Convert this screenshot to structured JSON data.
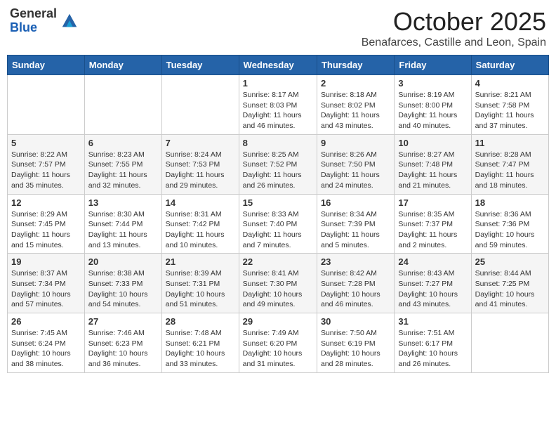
{
  "header": {
    "logo_general": "General",
    "logo_blue": "Blue",
    "month": "October 2025",
    "location": "Benafarces, Castille and Leon, Spain"
  },
  "days_of_week": [
    "Sunday",
    "Monday",
    "Tuesday",
    "Wednesday",
    "Thursday",
    "Friday",
    "Saturday"
  ],
  "weeks": [
    [
      {
        "day": "",
        "info": ""
      },
      {
        "day": "",
        "info": ""
      },
      {
        "day": "",
        "info": ""
      },
      {
        "day": "1",
        "info": "Sunrise: 8:17 AM\nSunset: 8:03 PM\nDaylight: 11 hours and 46 minutes."
      },
      {
        "day": "2",
        "info": "Sunrise: 8:18 AM\nSunset: 8:02 PM\nDaylight: 11 hours and 43 minutes."
      },
      {
        "day": "3",
        "info": "Sunrise: 8:19 AM\nSunset: 8:00 PM\nDaylight: 11 hours and 40 minutes."
      },
      {
        "day": "4",
        "info": "Sunrise: 8:21 AM\nSunset: 7:58 PM\nDaylight: 11 hours and 37 minutes."
      }
    ],
    [
      {
        "day": "5",
        "info": "Sunrise: 8:22 AM\nSunset: 7:57 PM\nDaylight: 11 hours and 35 minutes."
      },
      {
        "day": "6",
        "info": "Sunrise: 8:23 AM\nSunset: 7:55 PM\nDaylight: 11 hours and 32 minutes."
      },
      {
        "day": "7",
        "info": "Sunrise: 8:24 AM\nSunset: 7:53 PM\nDaylight: 11 hours and 29 minutes."
      },
      {
        "day": "8",
        "info": "Sunrise: 8:25 AM\nSunset: 7:52 PM\nDaylight: 11 hours and 26 minutes."
      },
      {
        "day": "9",
        "info": "Sunrise: 8:26 AM\nSunset: 7:50 PM\nDaylight: 11 hours and 24 minutes."
      },
      {
        "day": "10",
        "info": "Sunrise: 8:27 AM\nSunset: 7:48 PM\nDaylight: 11 hours and 21 minutes."
      },
      {
        "day": "11",
        "info": "Sunrise: 8:28 AM\nSunset: 7:47 PM\nDaylight: 11 hours and 18 minutes."
      }
    ],
    [
      {
        "day": "12",
        "info": "Sunrise: 8:29 AM\nSunset: 7:45 PM\nDaylight: 11 hours and 15 minutes."
      },
      {
        "day": "13",
        "info": "Sunrise: 8:30 AM\nSunset: 7:44 PM\nDaylight: 11 hours and 13 minutes."
      },
      {
        "day": "14",
        "info": "Sunrise: 8:31 AM\nSunset: 7:42 PM\nDaylight: 11 hours and 10 minutes."
      },
      {
        "day": "15",
        "info": "Sunrise: 8:33 AM\nSunset: 7:40 PM\nDaylight: 11 hours and 7 minutes."
      },
      {
        "day": "16",
        "info": "Sunrise: 8:34 AM\nSunset: 7:39 PM\nDaylight: 11 hours and 5 minutes."
      },
      {
        "day": "17",
        "info": "Sunrise: 8:35 AM\nSunset: 7:37 PM\nDaylight: 11 hours and 2 minutes."
      },
      {
        "day": "18",
        "info": "Sunrise: 8:36 AM\nSunset: 7:36 PM\nDaylight: 10 hours and 59 minutes."
      }
    ],
    [
      {
        "day": "19",
        "info": "Sunrise: 8:37 AM\nSunset: 7:34 PM\nDaylight: 10 hours and 57 minutes."
      },
      {
        "day": "20",
        "info": "Sunrise: 8:38 AM\nSunset: 7:33 PM\nDaylight: 10 hours and 54 minutes."
      },
      {
        "day": "21",
        "info": "Sunrise: 8:39 AM\nSunset: 7:31 PM\nDaylight: 10 hours and 51 minutes."
      },
      {
        "day": "22",
        "info": "Sunrise: 8:41 AM\nSunset: 7:30 PM\nDaylight: 10 hours and 49 minutes."
      },
      {
        "day": "23",
        "info": "Sunrise: 8:42 AM\nSunset: 7:28 PM\nDaylight: 10 hours and 46 minutes."
      },
      {
        "day": "24",
        "info": "Sunrise: 8:43 AM\nSunset: 7:27 PM\nDaylight: 10 hours and 43 minutes."
      },
      {
        "day": "25",
        "info": "Sunrise: 8:44 AM\nSunset: 7:25 PM\nDaylight: 10 hours and 41 minutes."
      }
    ],
    [
      {
        "day": "26",
        "info": "Sunrise: 7:45 AM\nSunset: 6:24 PM\nDaylight: 10 hours and 38 minutes."
      },
      {
        "day": "27",
        "info": "Sunrise: 7:46 AM\nSunset: 6:23 PM\nDaylight: 10 hours and 36 minutes."
      },
      {
        "day": "28",
        "info": "Sunrise: 7:48 AM\nSunset: 6:21 PM\nDaylight: 10 hours and 33 minutes."
      },
      {
        "day": "29",
        "info": "Sunrise: 7:49 AM\nSunset: 6:20 PM\nDaylight: 10 hours and 31 minutes."
      },
      {
        "day": "30",
        "info": "Sunrise: 7:50 AM\nSunset: 6:19 PM\nDaylight: 10 hours and 28 minutes."
      },
      {
        "day": "31",
        "info": "Sunrise: 7:51 AM\nSunset: 6:17 PM\nDaylight: 10 hours and 26 minutes."
      },
      {
        "day": "",
        "info": ""
      }
    ]
  ]
}
